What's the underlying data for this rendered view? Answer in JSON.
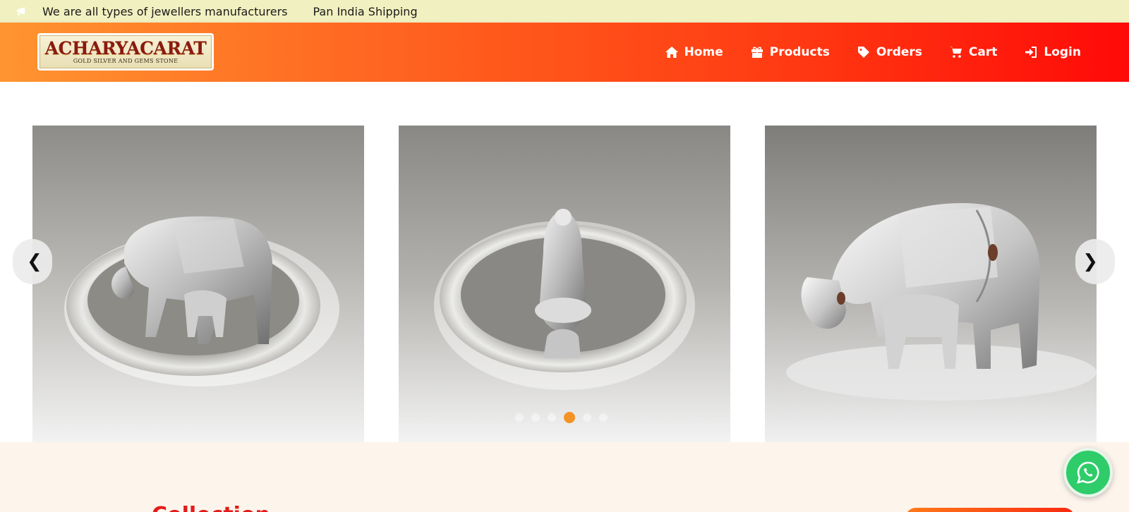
{
  "announcement": {
    "messages": [
      "We are all types of jewellers manufacturers",
      "Pan India Shipping"
    ],
    "icon": "megaphone-icon"
  },
  "header": {
    "logo": {
      "title": "ACHARYACARAT",
      "subtitle": "GOLD SILVER AND GEMS STONE"
    },
    "nav": [
      {
        "label": "Home",
        "icon": "home-icon"
      },
      {
        "label": "Products",
        "icon": "gift-icon"
      },
      {
        "label": "Orders",
        "icon": "tag-icon"
      },
      {
        "label": "Cart",
        "icon": "cart-icon"
      },
      {
        "label": "Login",
        "icon": "login-icon"
      }
    ]
  },
  "carousel": {
    "prev_label": "❮",
    "next_label": "❯",
    "slides": [
      {
        "subject": "silver cow and calf on plate"
      },
      {
        "subject": "silver ganesha idol on plate"
      },
      {
        "subject": "silver cow and calf figurine"
      }
    ],
    "dot_count": 6,
    "active_dot": 4
  },
  "lower_section": {
    "title_partial": "Collection"
  },
  "colors": {
    "topbar": "#f1f0c0",
    "header_start": "#ff9530",
    "header_end": "#ff0a08",
    "active_dot": "#f39326",
    "whatsapp": "#2fcc6a",
    "lower_bg": "#fdf5ec"
  }
}
